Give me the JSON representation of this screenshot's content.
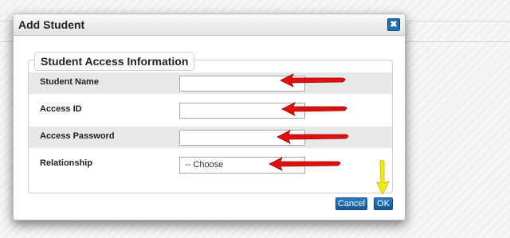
{
  "dialog": {
    "title": "Add Student",
    "close_icon": "close-icon",
    "section_title": "Student Access Information",
    "fields": [
      {
        "label": "Student Name",
        "value": "",
        "type": "text"
      },
      {
        "label": "Access ID",
        "value": "",
        "type": "text"
      },
      {
        "label": "Access Password",
        "value": "",
        "type": "password"
      },
      {
        "label": "Relationship",
        "value": "-- Choose",
        "type": "select"
      }
    ],
    "buttons": {
      "cancel": "Cancel",
      "ok": "OK"
    }
  },
  "annotations": {
    "field_arrows_color": "#e01010",
    "ok_arrow_color": "#f5f000"
  }
}
